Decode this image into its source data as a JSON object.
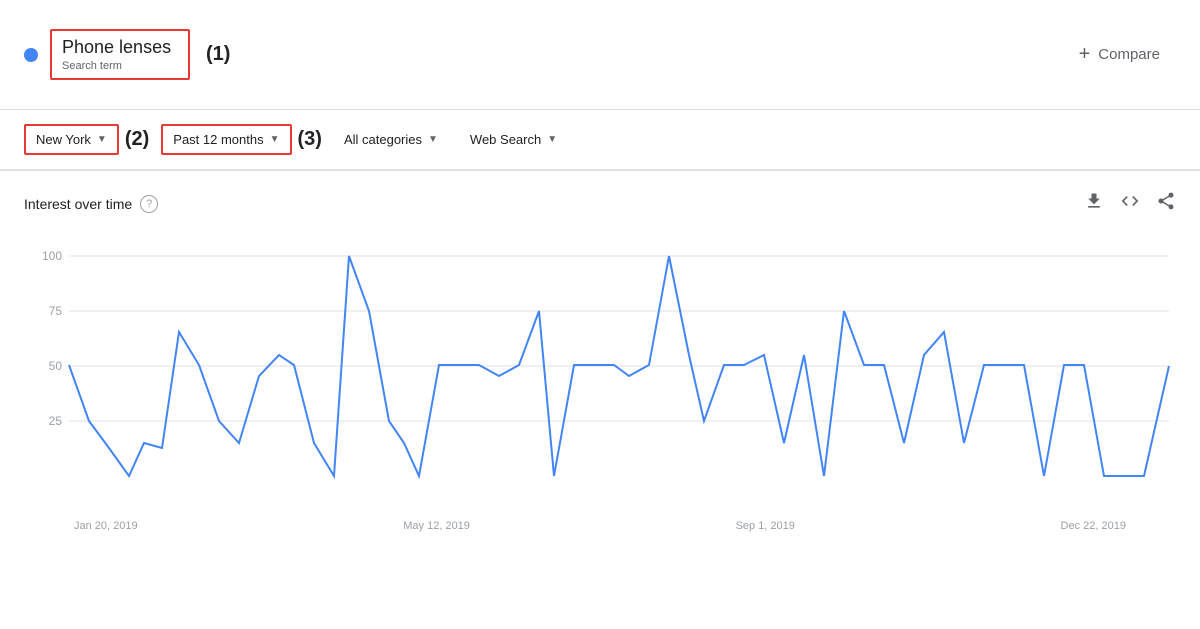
{
  "header": {
    "search_term": "Phone lenses",
    "search_term_subtitle": "Search term",
    "annotation": "(1)",
    "compare_label": "Compare",
    "compare_plus": "+"
  },
  "filters": {
    "location": {
      "label": "New York",
      "annotation": "(2)"
    },
    "time_range": {
      "label": "Past 12 months",
      "annotation": "(3)"
    },
    "categories": {
      "label": "All categories"
    },
    "search_type": {
      "label": "Web Search"
    }
  },
  "chart": {
    "title": "Interest over time",
    "x_labels": [
      "Jan 20, 2019",
      "May 12, 2019",
      "Sep 1, 2019",
      "Dec 22, 2019"
    ],
    "y_labels": [
      "100",
      "75",
      "50",
      "25"
    ],
    "download_icon": "↓",
    "embed_icon": "<>",
    "share_icon": "share"
  }
}
